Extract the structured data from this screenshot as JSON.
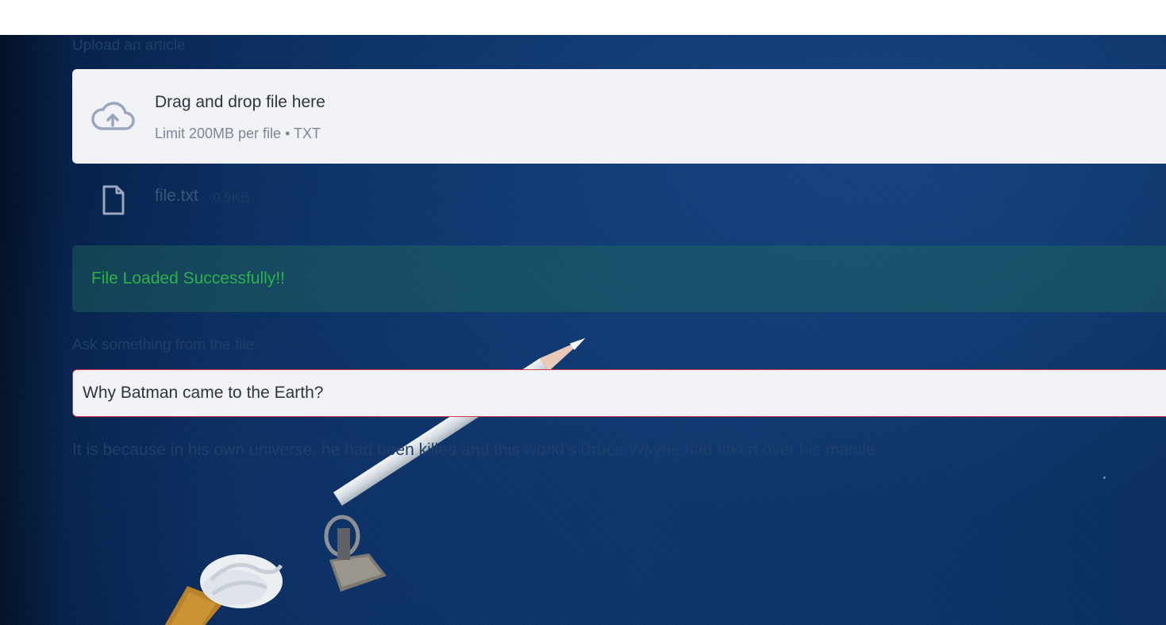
{
  "upload": {
    "label": "Upload an article",
    "drop_title": "Drag and drop file here",
    "limit_text": "Limit 200MB per file • TXT",
    "icon": "cloud-upload-icon"
  },
  "file": {
    "name": "file.txt",
    "size": "0.9KB",
    "icon": "file-icon"
  },
  "status": {
    "message": "File Loaded Successfully!!",
    "color": "#2bb04d"
  },
  "question": {
    "label": "Ask something from the file",
    "value": "Why Batman came to the Earth?"
  },
  "answer": {
    "text": "It is because in his own universe, he had been killed and this world's Bruce Wayne had taken over his mantle."
  },
  "colors": {
    "background": "#0c3469",
    "panel": "#f0f2f6",
    "input_border": "#d23a4c"
  }
}
